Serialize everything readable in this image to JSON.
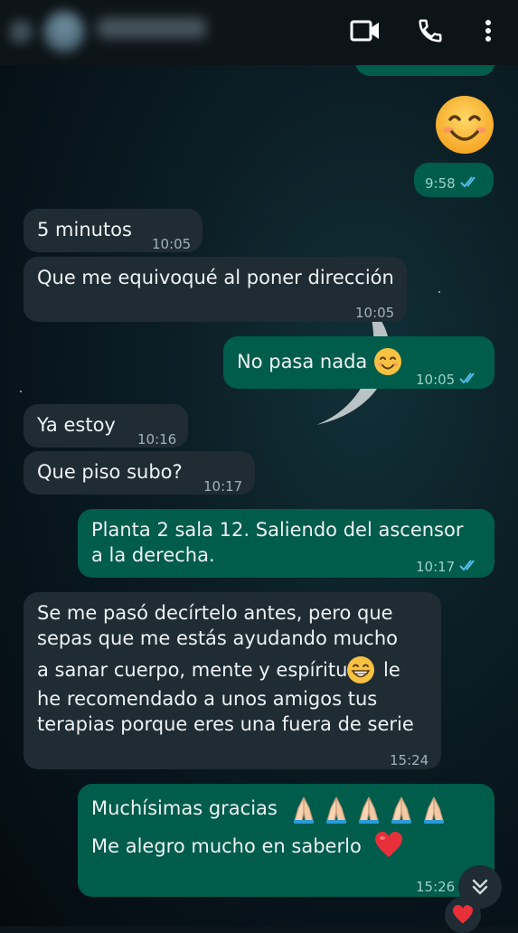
{
  "header": {
    "contact_name": "",
    "icons": [
      "back-icon",
      "video-call-icon",
      "voice-call-icon",
      "more-options-icon"
    ]
  },
  "messages": [
    {
      "dir": "out",
      "text": "",
      "emoji": "smiling-face-emoji",
      "time": "9:58",
      "status": "read"
    },
    {
      "dir": "in",
      "text": "5 minutos",
      "time": "10:05"
    },
    {
      "dir": "in",
      "text": "Que me equivoqué al poner dirección",
      "time": "10:05"
    },
    {
      "dir": "out",
      "text": "No pasa nada",
      "emoji": "smiling-face-emoji",
      "time": "10:05",
      "status": "read"
    },
    {
      "dir": "in",
      "text": "Ya estoy",
      "time": "10:16"
    },
    {
      "dir": "in",
      "text": "Que piso subo?",
      "time": "10:17"
    },
    {
      "dir": "out",
      "lines": [
        "Planta 2 sala 12. Saliendo del ascensor",
        "a la derecha."
      ],
      "time": "10:17",
      "status": "read"
    },
    {
      "dir": "in",
      "lines": [
        "Se me pasó decírtelo antes, pero que",
        "sepas que me estás ayudando mucho",
        "a sanar cuerpo, mente y espíritu",
        "he recomendado a unos amigos tus",
        "terapias porque eres una fuera de serie"
      ],
      "line3_suffix": "le",
      "emoji": "grinning-face-emoji",
      "time": "15:24"
    },
    {
      "dir": "out",
      "lines": [
        "Muchísimas gracias",
        "Me alegro mucho en saberlo"
      ],
      "emojis": [
        "folded-hands-emoji",
        "red-heart-emoji"
      ],
      "time": "15:26",
      "status": "read",
      "reaction": "red-heart-emoji"
    }
  ],
  "colors": {
    "incoming_bubble": "#1f2c34",
    "outgoing_bubble": "#005c4b",
    "read_ticks": "#53bdeb"
  }
}
